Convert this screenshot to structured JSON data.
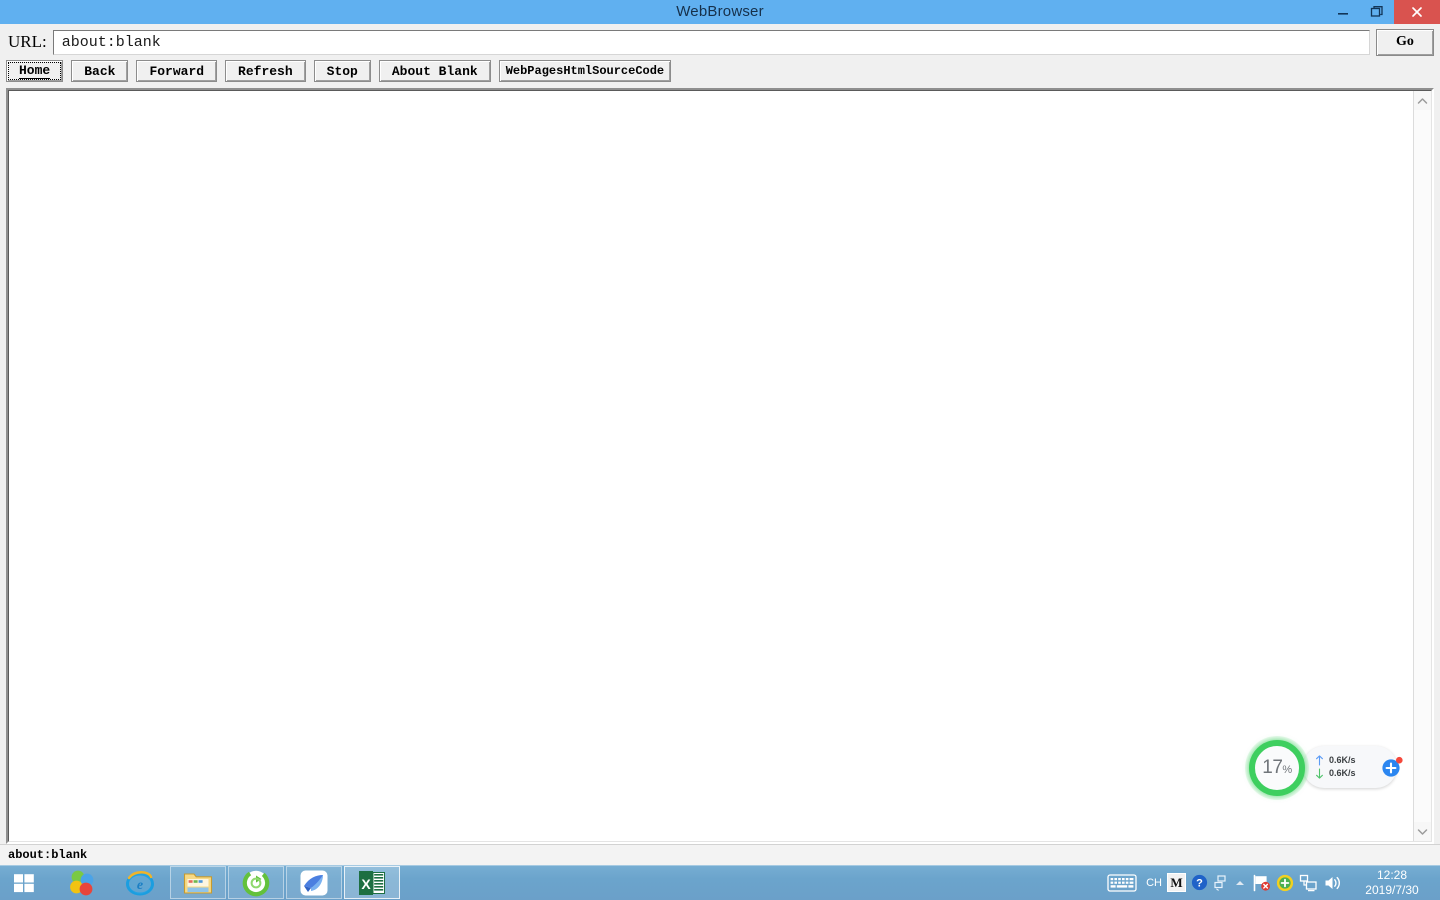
{
  "window": {
    "title": "WebBrowser",
    "controls": {
      "minimize": "minimize-button",
      "restore": "restore-button",
      "close": "close-button"
    }
  },
  "address": {
    "label": "URL:",
    "value": "about:blank",
    "placeholder": "about:blank",
    "go_label": "Go"
  },
  "toolbar": {
    "buttons": [
      {
        "label": "Home",
        "name": "home-button",
        "focused": true
      },
      {
        "label": "Back",
        "name": "back-button",
        "focused": false
      },
      {
        "label": "Forward",
        "name": "forward-button",
        "focused": false
      },
      {
        "label": "Refresh",
        "name": "refresh-button",
        "focused": false
      },
      {
        "label": "Stop",
        "name": "stop-button",
        "focused": false
      },
      {
        "label": "About Blank",
        "name": "about-blank-button",
        "focused": false
      },
      {
        "label": "WebPagesHtmlSourceCode",
        "name": "view-source-button",
        "focused": false
      }
    ]
  },
  "page": {
    "content": ""
  },
  "statusbar": {
    "text": "about:blank"
  },
  "net_widget": {
    "percent_value": "17",
    "percent_symbol": "%",
    "upload_rate": "0.6K/s",
    "download_rate": "0.6K/s",
    "ring_color": "#3ecf5f",
    "badge_color": "#2b86f0",
    "badge_dot_color": "#f5483b"
  },
  "taskbar": {
    "start": "start-button",
    "apps": [
      {
        "name": "taskbar-app-circles",
        "state": "pinned"
      },
      {
        "name": "taskbar-app-internet-explorer",
        "state": "pinned"
      },
      {
        "name": "taskbar-app-file-explorer",
        "state": "pinned"
      },
      {
        "name": "taskbar-app-360-browser",
        "state": "pinned"
      },
      {
        "name": "taskbar-app-bird",
        "state": "pinned"
      },
      {
        "name": "taskbar-app-excel",
        "state": "active"
      }
    ],
    "tray": {
      "ime_language": "CH",
      "ime_mode": "M",
      "items": [
        "touch-keyboard-icon",
        "help-icon",
        "network-tray-icon",
        "show-hidden-icons-icon",
        "action-center-flag-icon",
        "security-shield-icon",
        "network-monitor-icon",
        "volume-icon"
      ]
    },
    "clock": {
      "time": "12:28",
      "date": "2019/7/30"
    }
  },
  "colors": {
    "titlebar": "#60b0f0",
    "close_button": "#d9534f",
    "taskbar": "#6ba4cc",
    "window_face": "#f0f0f0"
  }
}
